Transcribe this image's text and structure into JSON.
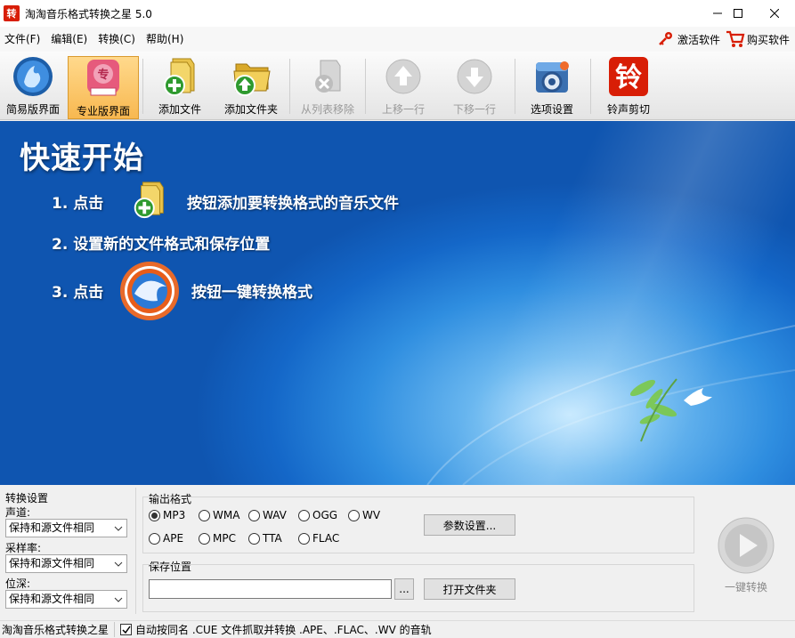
{
  "window": {
    "app_icon_char": "转",
    "title": "淘淘音乐格式转换之星 5.0"
  },
  "menu": {
    "items": [
      "文件(F)",
      "编辑(E)",
      "转换(C)",
      "帮助(H)"
    ],
    "activate_label": "激活软件",
    "buy_label": "购买软件"
  },
  "toolbar": {
    "simple_ui": "简易版界面",
    "pro_ui": "专业版界面",
    "pro_icon_char": "专",
    "add_file": "添加文件",
    "add_folder": "添加文件夹",
    "remove": "从列表移除",
    "move_up": "上移一行",
    "move_down": "下移一行",
    "options": "选项设置",
    "ringtone": "铃声剪切",
    "ringtone_icon_char": "铃"
  },
  "banner": {
    "heading": "快速开始",
    "step1_prefix": "1.  点击",
    "step1_suffix": "按钮添加要转换格式的音乐文件",
    "step2": "2.  设置新的文件格式和保存位置",
    "step3_prefix": "3.  点击",
    "step3_suffix": "按钮一键转换格式"
  },
  "conversion": {
    "group_title": "转换设置",
    "channel_label": "声道:",
    "channel_value": "保持和源文件相同",
    "samplerate_label": "采样率:",
    "samplerate_value": "保持和源文件相同",
    "bitdepth_label": "位深:",
    "bitdepth_value": "保持和源文件相同"
  },
  "output": {
    "group_title": "输出格式",
    "formats": [
      "MP3",
      "WMA",
      "WAV",
      "OGG",
      "WV",
      "APE",
      "MPC",
      "TTA",
      "FLAC"
    ],
    "selected": "MP3",
    "params_button": "参数设置..."
  },
  "save": {
    "group_title": "保存位置",
    "path_value": "",
    "browse_button": "...",
    "open_folder_button": "打开文件夹"
  },
  "convert": {
    "label": "一键转换"
  },
  "status": {
    "app_name": "淘淘音乐格式转换之星",
    "cue_checked": true,
    "cue_text": "自动按同名 .CUE 文件抓取并转换 .APE、.FLAC、.WV 的音轨"
  },
  "colors": {
    "banner_blue": "#1467c8",
    "active_tab": "#f8b850",
    "ringtone_red": "#d81e06"
  }
}
